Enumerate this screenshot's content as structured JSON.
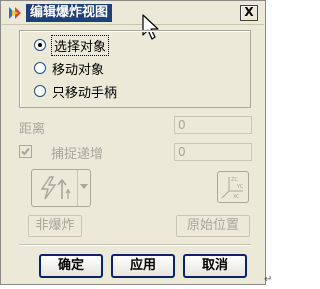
{
  "window": {
    "title": "编辑爆炸视图",
    "close_glyph": "X"
  },
  "move_group": {
    "options": [
      {
        "label": "选择对象",
        "checked": true
      },
      {
        "label": "移动对象",
        "checked": false
      },
      {
        "label": "只移动手柄",
        "checked": false
      }
    ]
  },
  "distance": {
    "label": "距离",
    "value": "0"
  },
  "snap_increment": {
    "label": "捕捉递增",
    "value": "0",
    "checked": true
  },
  "tools": {
    "move_tool_icon": "move-arrows-icon",
    "axis_icon": "csys-axis-icon",
    "axis_labels": [
      "ZC",
      "YC",
      "XC"
    ]
  },
  "buttons": {
    "unexplode": "非爆炸",
    "original_position": "原始位置",
    "ok": "确定",
    "apply": "应用",
    "cancel": "取消"
  },
  "colors": {
    "dialog_bg": "#ece9d8",
    "title_bg": "#1f3f7a",
    "default_button_border": "#0a246a"
  }
}
